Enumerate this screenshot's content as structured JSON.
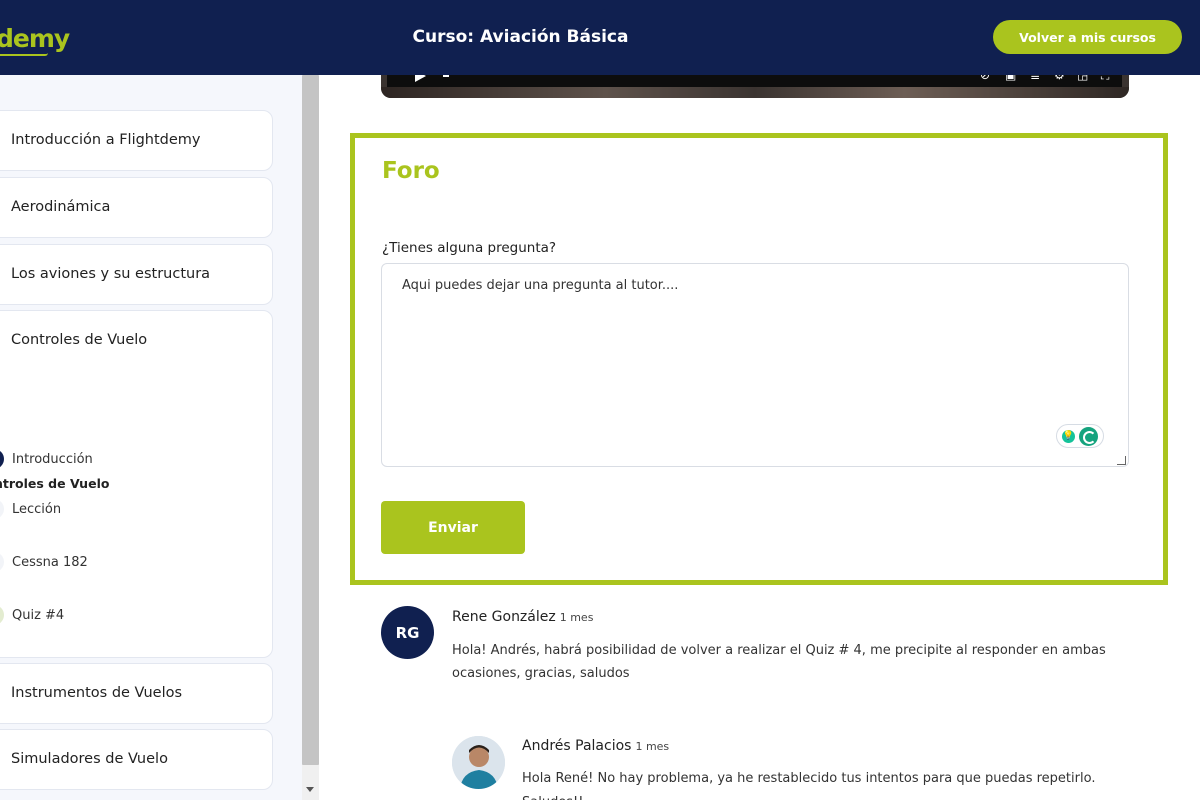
{
  "header": {
    "logo_text": "demy",
    "course_title": "Curso: Aviación Básica",
    "back_button": "Volver a mis cursos"
  },
  "colors": {
    "navy": "#102050",
    "accent_green": "#aac41e",
    "sidebar_bg": "#f5f7fc"
  },
  "sidebar": {
    "modules": [
      {
        "label": "Introducción a Flightdemy"
      },
      {
        "label": "Aerodinámica"
      },
      {
        "label": "Los aviones y su estructura"
      },
      {
        "label": "Controles de Vuelo"
      },
      {
        "label": "Instrumentos de Vuelos"
      },
      {
        "label": "Simuladores de Vuelo"
      }
    ],
    "expanded_heading": "ntroles de Vuelo",
    "lessons": [
      {
        "label": "Introducción",
        "state": "current"
      },
      {
        "label": "Lección",
        "state": "pending"
      },
      {
        "label": "Cessna 182",
        "state": "pending"
      },
      {
        "label": "Quiz #4",
        "state": "done"
      }
    ]
  },
  "video": {
    "icons": [
      "play-icon",
      "autoplay-icon",
      "subtitles-icon",
      "transcript-icon",
      "settings-icon",
      "miniplayer-icon",
      "fullscreen-icon"
    ]
  },
  "forum": {
    "title": "Foro",
    "question_label": "¿Tienes alguna pregunta?",
    "question_value": "Aqui puedes dejar una pregunta al tutor....",
    "send_button": "Enviar"
  },
  "comments": [
    {
      "initials": "RG",
      "author": "Rene González",
      "time": "1 mes",
      "text": "Hola! Andrés, habrá posibilidad de volver a realizar el Quiz # 4, me precipite al responder en ambas ocasiones, gracias, saludos"
    }
  ],
  "replies": [
    {
      "author": "Andrés Palacios",
      "time": "1 mes",
      "text": "Hola René! No hay problema, ya he restablecido tus intentos para que puedas repetirlo. Saludos!!"
    }
  ]
}
